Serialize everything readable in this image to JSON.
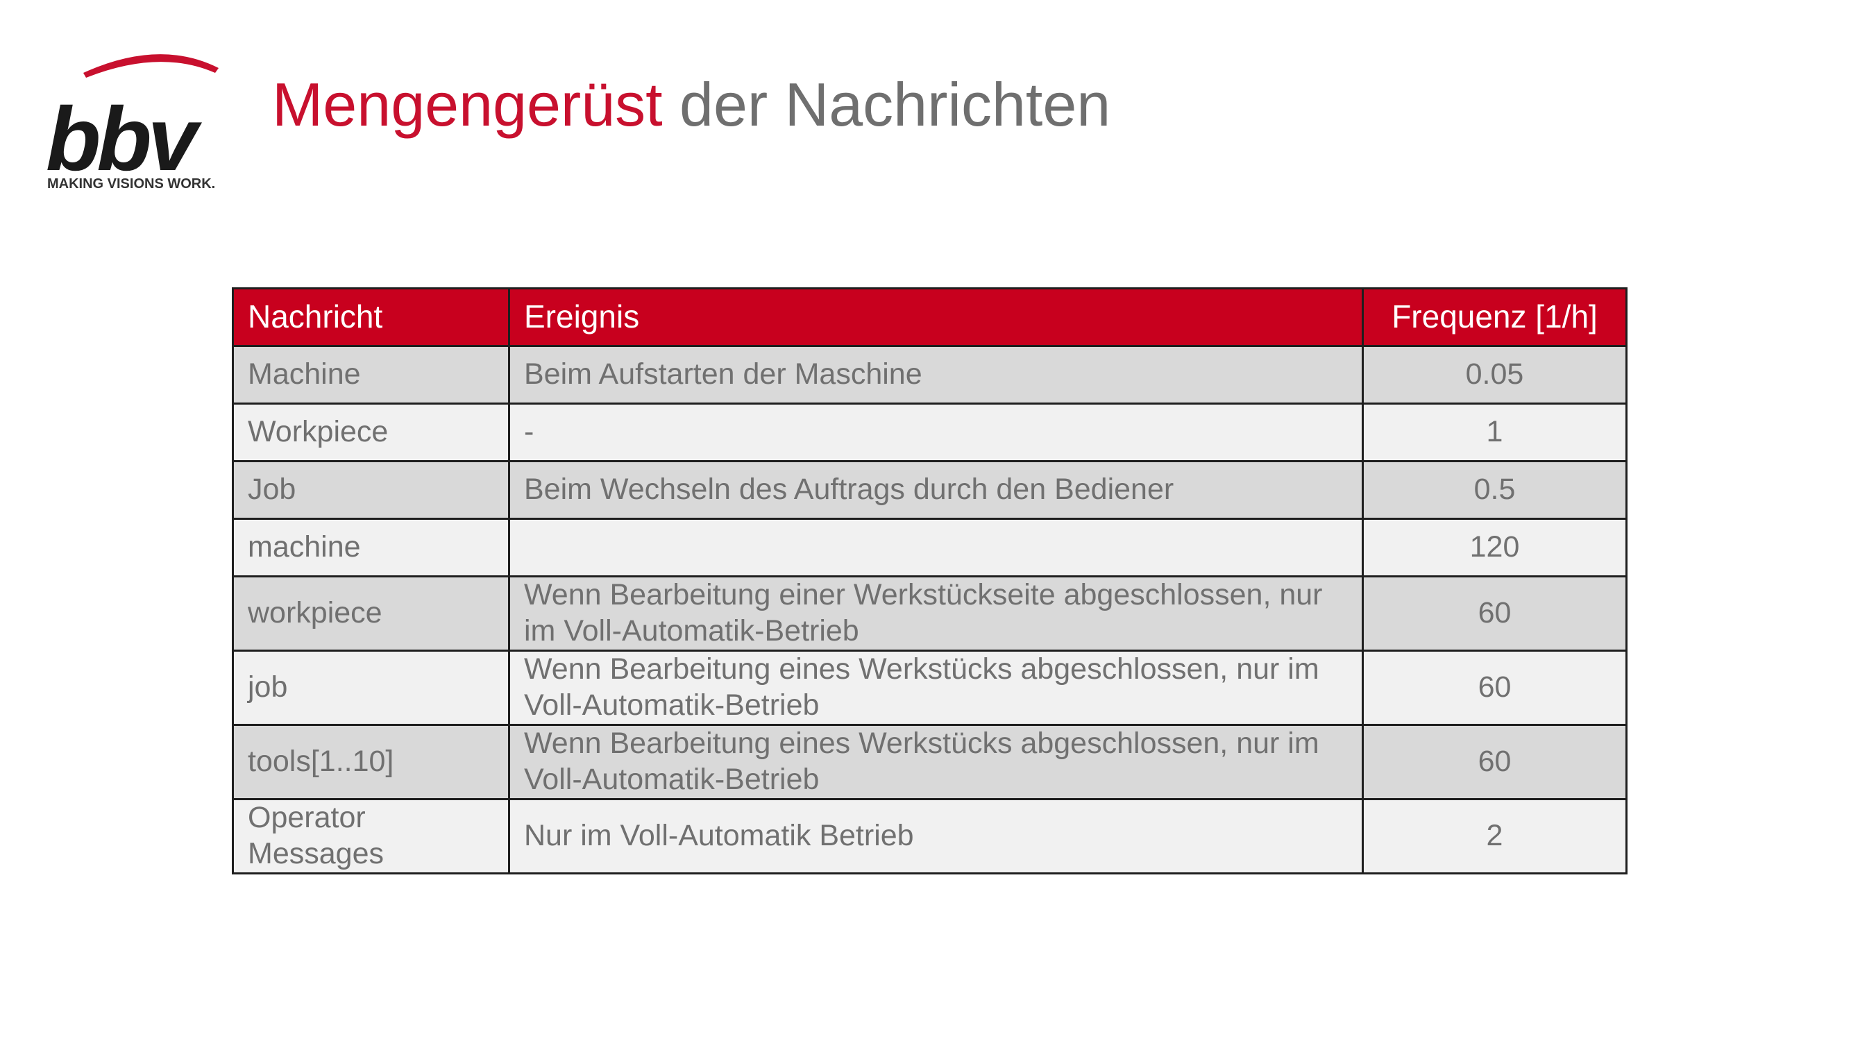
{
  "logo": {
    "brand": "bbv",
    "tagline": "MAKING VISIONS WORK.",
    "accent_color": "#c8102e"
  },
  "title": {
    "highlight": "Mengengerüst",
    "rest": " der Nachrichten"
  },
  "table": {
    "headers": {
      "message": "Nachricht",
      "event": "Ereignis",
      "frequency": "Frequenz [1/h]"
    },
    "rows": [
      {
        "message": "Machine",
        "event": "Beim Aufstarten der Maschine",
        "frequency": "0.05"
      },
      {
        "message": "Workpiece",
        "event": "-",
        "frequency": "1"
      },
      {
        "message": "Job",
        "event": "Beim Wechseln des Auftrags durch den Bediener",
        "frequency": "0.5"
      },
      {
        "message": "machine",
        "event": "",
        "frequency": "120"
      },
      {
        "message": "workpiece",
        "event": "Wenn Bearbeitung einer Werkstückseite abgeschlossen, nur im Voll-Automatik-Betrieb",
        "frequency": "60"
      },
      {
        "message": "job",
        "event": "Wenn Bearbeitung eines Werkstücks abgeschlossen, nur im Voll-Automatik-Betrieb",
        "frequency": "60"
      },
      {
        "message": "tools[1..10]",
        "event": "Wenn Bearbeitung eines Werkstücks abgeschlossen, nur im Voll-Automatik-Betrieb",
        "frequency": "60"
      },
      {
        "message": "Operator Messages",
        "event": "Nur im Voll-Automatik Betrieb",
        "frequency": "2"
      }
    ],
    "header_color": "#c8001e",
    "row_colors": [
      "#d9d9d9",
      "#f1f1f1"
    ]
  }
}
